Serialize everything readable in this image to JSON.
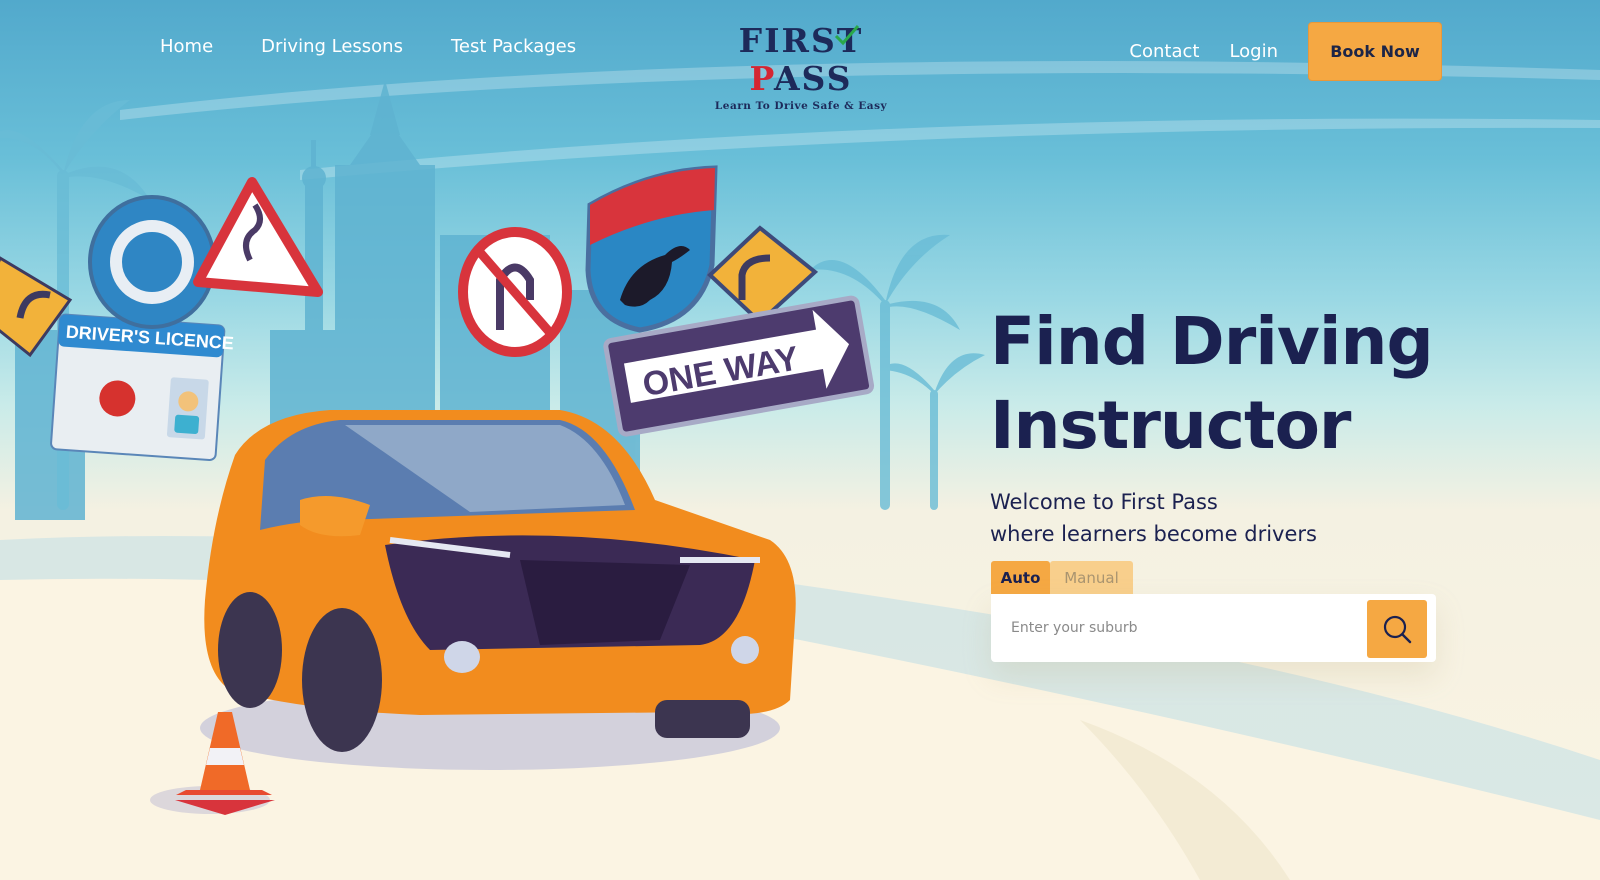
{
  "nav": {
    "left_links": [
      "Home",
      "Driving Lessons",
      "Test Packages"
    ],
    "contact": "Contact",
    "login": "Login",
    "book_now": "Book Now"
  },
  "logo": {
    "word_first": "FIRST ",
    "word_p": "P",
    "word_rest": "ASS",
    "tagline": "Learn To Drive Safe & Easy"
  },
  "illustration": {
    "licence_text": "DRIVER'S LICENCE",
    "sign_text": "ONE WAY"
  },
  "hero": {
    "title_line1": "Find Driving",
    "title_line2": "Instructor",
    "subtitle_line1": "Welcome to First Pass",
    "subtitle_line2": "where learners become drivers"
  },
  "search": {
    "tabs": [
      "Auto",
      "Manual"
    ],
    "active_tab": "Auto",
    "placeholder": "Enter your suburb",
    "value": ""
  },
  "colors": {
    "accent": "#f5a843",
    "navy": "#1b2150",
    "sky": "#52a9cc"
  }
}
